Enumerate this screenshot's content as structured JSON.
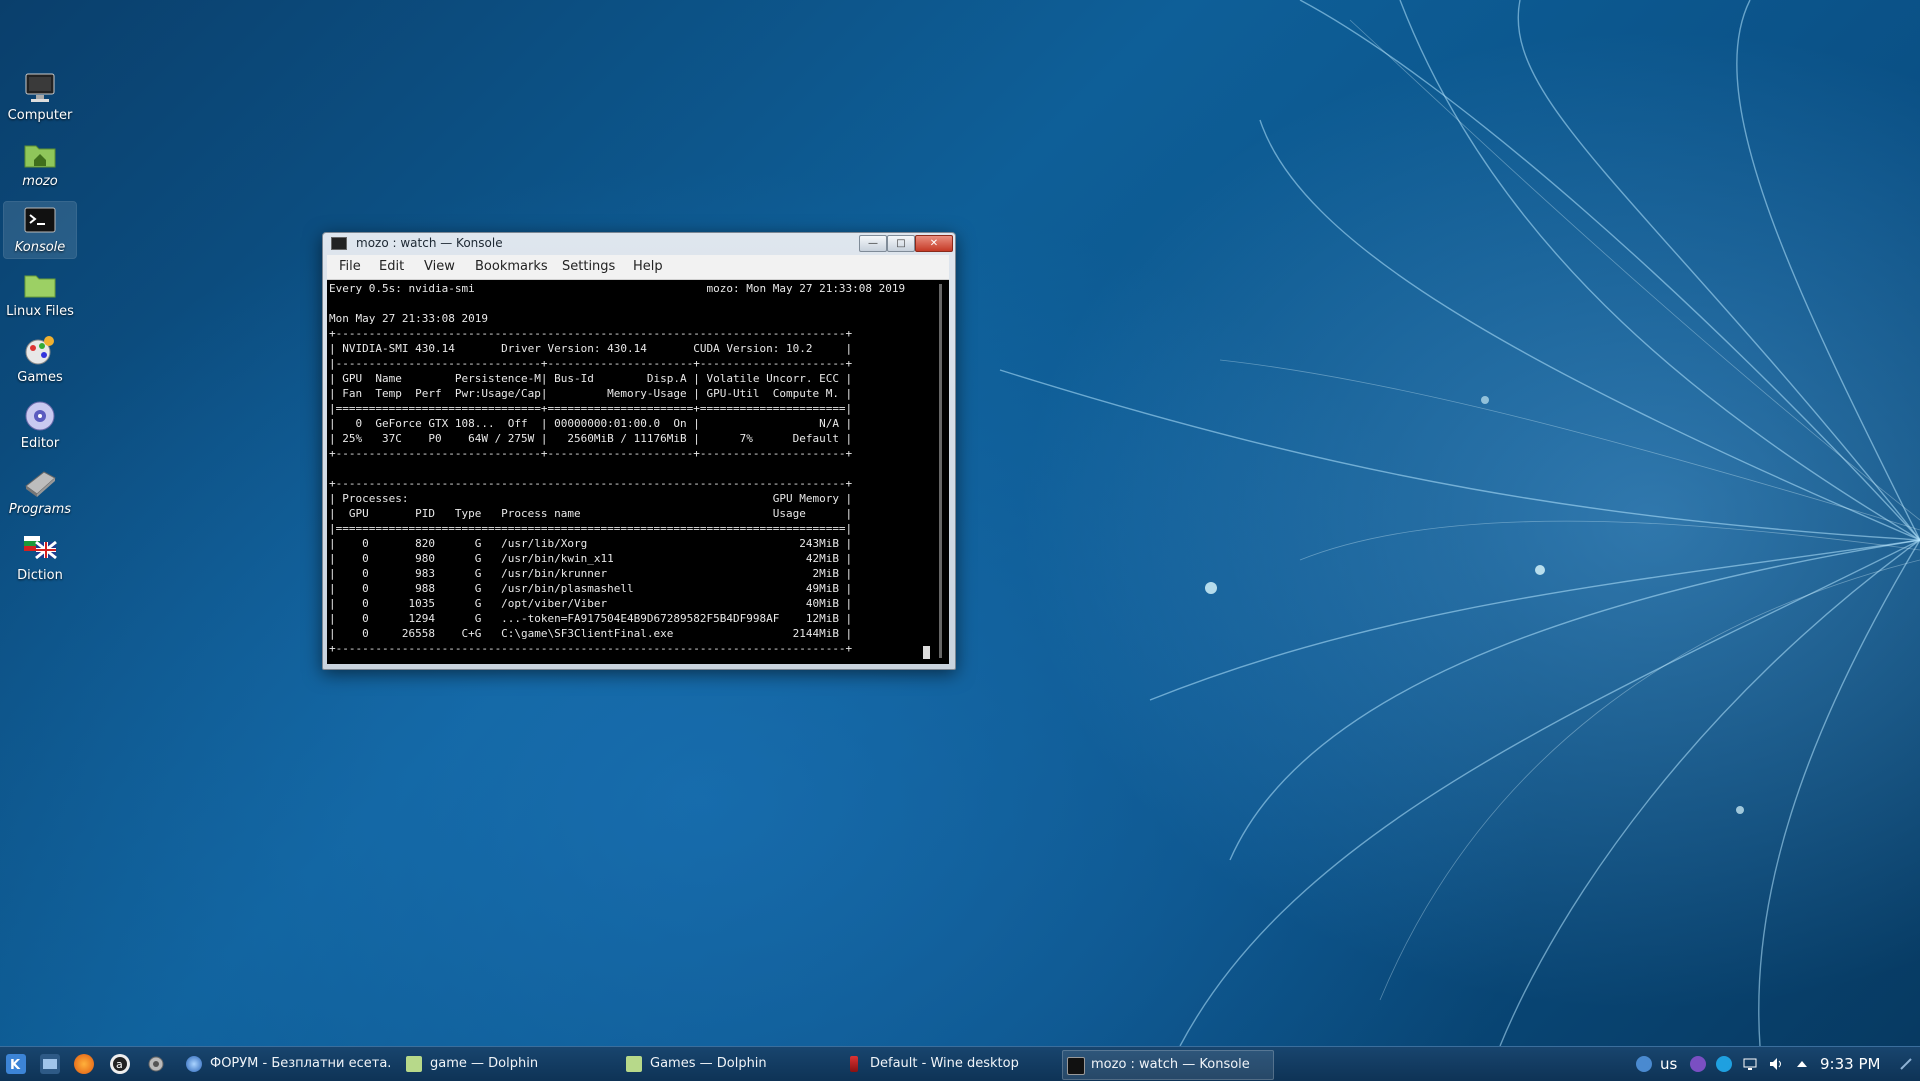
{
  "desktop": {
    "icons": [
      {
        "label": "Computer",
        "italic": false,
        "icon": "monitor-icon"
      },
      {
        "label": "mozo",
        "italic": true,
        "icon": "home-folder-icon"
      },
      {
        "label": "Konsole",
        "italic": true,
        "icon": "terminal-icon"
      },
      {
        "label": "Linux Files",
        "italic": false,
        "icon": "folder-icon"
      },
      {
        "label": "Games",
        "italic": false,
        "icon": "games-icon"
      },
      {
        "label": "Editor",
        "italic": false,
        "icon": "editor-icon"
      },
      {
        "label": "Programs",
        "italic": true,
        "icon": "programs-icon"
      },
      {
        "label": "Diction",
        "italic": false,
        "icon": "flag-icon"
      }
    ]
  },
  "window": {
    "title": "mozo : watch — Konsole",
    "buttons": {
      "minimize": "—",
      "maximize": "□",
      "close": "✕"
    },
    "menu": [
      "File",
      "Edit",
      "View",
      "Bookmarks",
      "Settings",
      "Help"
    ],
    "terminal_lines": [
      "Every 0.5s: nvidia-smi                                   mozo: Mon May 27 21:33:08 2019",
      "",
      "Mon May 27 21:33:08 2019",
      "+-----------------------------------------------------------------------------+",
      "| NVIDIA-SMI 430.14       Driver Version: 430.14       CUDA Version: 10.2     |",
      "|-------------------------------+----------------------+----------------------+",
      "| GPU  Name        Persistence-M| Bus-Id        Disp.A | Volatile Uncorr. ECC |",
      "| Fan  Temp  Perf  Pwr:Usage/Cap|         Memory-Usage | GPU-Util  Compute M. |",
      "|===============================+======================+======================|",
      "|   0  GeForce GTX 108...  Off  | 00000000:01:00.0  On |                  N/A |",
      "| 25%   37C    P0    64W / 275W |   2560MiB / 11176MiB |      7%      Default |",
      "+-------------------------------+----------------------+----------------------+",
      "",
      "+-----------------------------------------------------------------------------+",
      "| Processes:                                                       GPU Memory |",
      "|  GPU       PID   Type   Process name                             Usage      |",
      "|=============================================================================|",
      "|    0       820      G   /usr/lib/Xorg                                243MiB |",
      "|    0       980      G   /usr/bin/kwin_x11                             42MiB |",
      "|    0       983      G   /usr/bin/krunner                               2MiB |",
      "|    0       988      G   /usr/bin/plasmashell                          49MiB |",
      "|    0      1035      G   /opt/viber/Viber                              40MiB |",
      "|    0      1294      G   ...-token=FA917504E4B9D67289582F5B4DF998AF    12MiB |",
      "|    0     26558    C+G   C:\\game\\SF3ClientFinal.exe                  2144MiB |",
      "+-----------------------------------------------------------------------------+"
    ]
  },
  "taskbar": {
    "tasks": [
      {
        "label": "ФОРУМ - Безплатни есета...",
        "icon": "browser-globe-icon",
        "active": false
      },
      {
        "label": "game — Dolphin",
        "icon": "dolphin-folder-icon",
        "active": false
      },
      {
        "label": "Games — Dolphin",
        "icon": "dolphin-folder-icon",
        "active": false
      },
      {
        "label": "Default - Wine desktop",
        "icon": "wine-icon",
        "active": false
      },
      {
        "label": "mozo : watch — Konsole",
        "icon": "terminal-icon",
        "active": true
      }
    ],
    "tray": {
      "language": "us",
      "clock": "9:33 PM"
    },
    "colors": {
      "accent": "#3b6e9c"
    }
  }
}
